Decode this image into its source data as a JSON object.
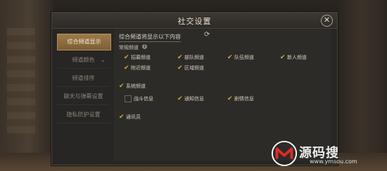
{
  "window": {
    "title": "社交设置",
    "close_label": "✕"
  },
  "sidebar": {
    "items": [
      {
        "label": "综合频道显示",
        "active": true
      },
      {
        "label": "频道颜色",
        "has_dropdown": true
      },
      {
        "label": "频道排序"
      },
      {
        "label": "聊天与弹幕设置"
      },
      {
        "label": "隐私防护设置"
      }
    ]
  },
  "content": {
    "info_text": "综合频道将显示以下内容",
    "refresh_icon": "refresh-icon",
    "regular_section": {
      "label": "常规频道",
      "info_icon": "i"
    },
    "regular_channels": [
      {
        "label": "招募频道",
        "checked": true
      },
      {
        "label": "部队频道",
        "checked": true
      },
      {
        "label": "队伍频道",
        "checked": true
      },
      {
        "label": "新人频道",
        "checked": true
      },
      {
        "label": "附近频道",
        "checked": true
      },
      {
        "label": "区域频道",
        "checked": true
      }
    ],
    "system_channel": {
      "label": "系统频道",
      "checked": true
    },
    "system_sub": [
      {
        "label": "战斗信息",
        "checked": false
      },
      {
        "label": "通知信息",
        "checked": true
      },
      {
        "label": "剧情信息",
        "checked": true
      }
    ],
    "communicator": {
      "label": "通讯员",
      "checked": true
    }
  },
  "watermark": {
    "text": "源码搜",
    "url": "www.ymsou.com"
  },
  "colors": {
    "accent": "#d8a640",
    "active_tab": "#9e7a49",
    "panel": "#272624"
  }
}
